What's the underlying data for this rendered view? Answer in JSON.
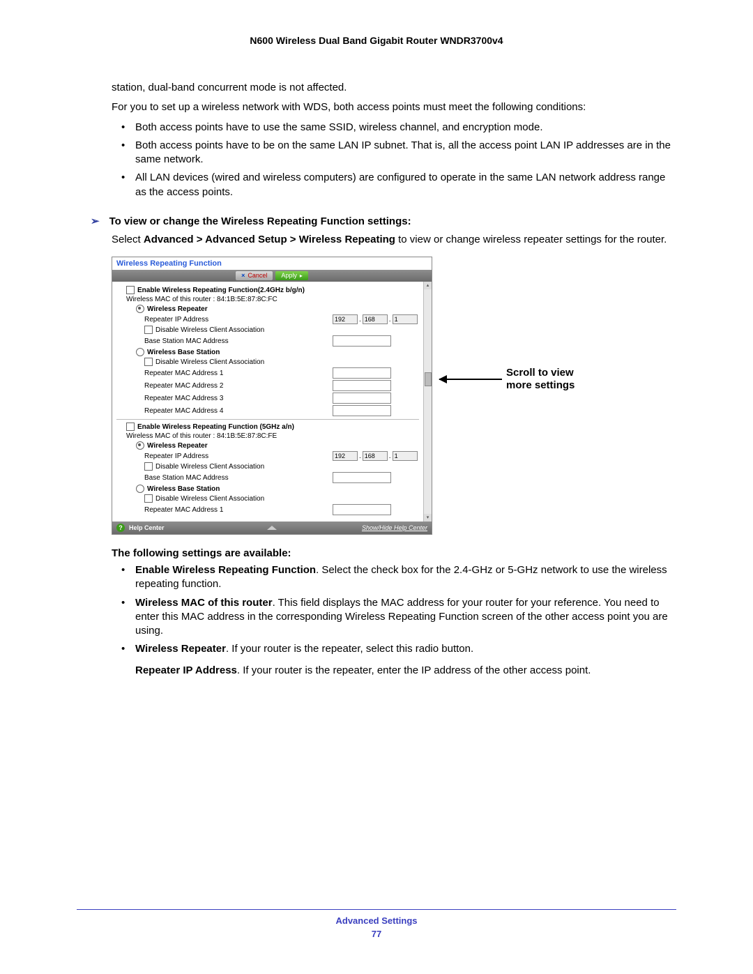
{
  "header": {
    "title": "N600 Wireless Dual Band Gigabit Router WNDR3700v4"
  },
  "intro": {
    "l1": "station, dual-band concurrent mode is not affected.",
    "l2": "For you to set up a wireless network with WDS, both access points must meet the following conditions:"
  },
  "conditions": {
    "b1": "Both access points have to use the same SSID, wireless channel, and encryption mode.",
    "b2": "Both access points have to be on the same LAN IP subnet. That is, all the access point LAN IP addresses are in the same network.",
    "b3": "All LAN devices (wired and wireless computers) are configured to operate in the same LAN network address range as the access points."
  },
  "proc": {
    "heading": "To view or change the Wireless Repeating Function settings:",
    "step_pre": "Select ",
    "step_bold": "Advanced > Advanced Setup > Wireless Repeating",
    "step_post": " to view or change wireless repeater settings for the router."
  },
  "ui": {
    "title": "Wireless Repeating Function",
    "cancel": "Cancel",
    "apply": "Apply",
    "band24": {
      "enable_label": "Enable Wireless Repeating Function(2.4GHz b/g/n)",
      "mac_label": "Wireless MAC of this router : 84:1B:5E:87:8C:FC",
      "repeater_label": "Wireless Repeater",
      "repeater_ip": "Repeater IP Address",
      "ip": {
        "a": "192",
        "b": "168",
        "c": "1",
        "d": ""
      },
      "disable_assoc": "Disable Wireless Client Association",
      "base_mac": "Base Station MAC Address",
      "base_label": "Wireless Base Station",
      "disable_assoc2": "Disable Wireless Client Association",
      "rmac1": "Repeater MAC Address 1",
      "rmac2": "Repeater MAC Address 2",
      "rmac3": "Repeater MAC Address 3",
      "rmac4": "Repeater MAC Address 4"
    },
    "band5": {
      "enable_label": "Enable Wireless Repeating Function (5GHz a/n)",
      "mac_label": "Wireless MAC of this router : 84:1B:5E:87:8C:FE",
      "repeater_label": "Wireless Repeater",
      "repeater_ip": "Repeater IP Address",
      "ip": {
        "a": "192",
        "b": "168",
        "c": "1",
        "d": ""
      },
      "disable_assoc": "Disable Wireless Client Association",
      "base_mac": "Base Station MAC Address",
      "base_label": "Wireless Base Station",
      "disable_assoc2": "Disable Wireless Client Association",
      "rmac1": "Repeater MAC Address 1"
    },
    "help": {
      "label": "Help Center",
      "show": "Show/Hide Help Center"
    }
  },
  "callout": {
    "l1": "Scroll to view",
    "l2": "more settings"
  },
  "after": {
    "heading": "The following settings are available:",
    "items": {
      "i1b": "Enable Wireless Repeating Function",
      "i1": ". Select the check box for the 2.4-GHz or 5-GHz network to use the wireless repeating function.",
      "i2b": "Wireless MAC of this router",
      "i2": ". This field displays the MAC address for your router for your reference. You need to enter this MAC address in the corresponding Wireless Repeating Function screen of the other access point you are using.",
      "i3b": "Wireless Repeater",
      "i3": ". If your router is the repeater, select this radio button.",
      "i4b": "Repeater IP Address",
      "i4": ". If your router is the repeater, enter the IP address of the other access point."
    }
  },
  "footer": {
    "title": "Advanced Settings",
    "page": "77"
  }
}
